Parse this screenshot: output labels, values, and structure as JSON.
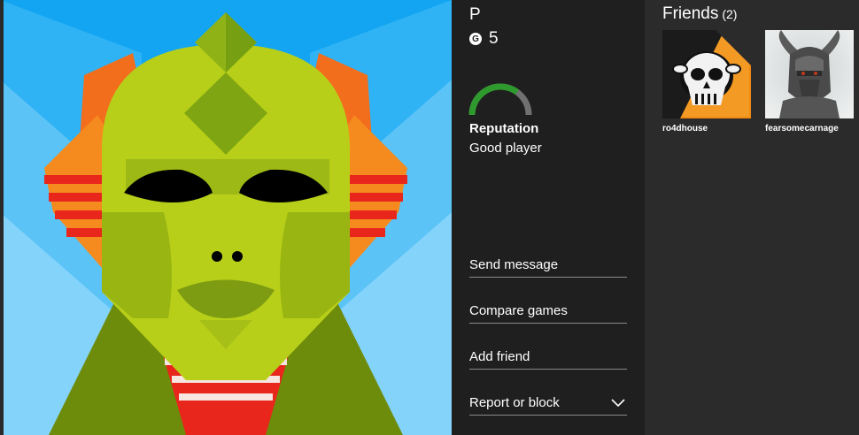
{
  "profile": {
    "gamertag": "P",
    "gamerscore_icon": "G",
    "gamerscore": "5",
    "reputation_title": "Reputation",
    "reputation_value": "Good player",
    "reputation_level": 0.7
  },
  "actions": {
    "send_message": "Send message",
    "compare_games": "Compare games",
    "add_friend": "Add friend",
    "report_block": "Report or block"
  },
  "friends": {
    "title": "Friends",
    "count": "(2)",
    "items": [
      {
        "name": "ro4dhouse",
        "icon": "skull-avatar"
      },
      {
        "name": "fearsomecarnage",
        "icon": "armored-warrior-avatar"
      }
    ]
  },
  "colors": {
    "reputation_green": "#2e9a2e",
    "reputation_gray": "#707070",
    "avatar_skin": "#b5cc1a",
    "avatar_bg": "#19a7f0"
  }
}
